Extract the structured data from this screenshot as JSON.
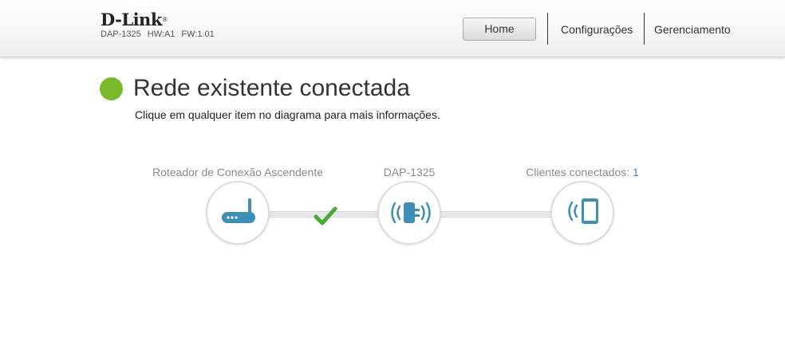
{
  "header": {
    "brand": "D-Link",
    "brand_mark": "®",
    "model": "DAP-1325",
    "hardware": "HW:A1",
    "firmware": "FW:1.01"
  },
  "nav": {
    "home": "Home",
    "settings": "Configurações",
    "management": "Gerenciamento"
  },
  "status": {
    "title": "Rede existente conectada",
    "subtitle": "Clique em qualquer item no diagrama para mais informações.",
    "color": "#7ab929"
  },
  "diagram": {
    "router": {
      "label": "Roteador de Conexão Ascendente",
      "icon": "router-icon"
    },
    "extender": {
      "label": "DAP-1325",
      "icon": "extender-icon"
    },
    "clients": {
      "label": "Clientes conectados:",
      "count": "1",
      "icon": "tablet-icon"
    },
    "link_status_icon": "checkmark-icon",
    "accent_color": "#3a8fc6",
    "icon_color": "#3d8fb8"
  }
}
